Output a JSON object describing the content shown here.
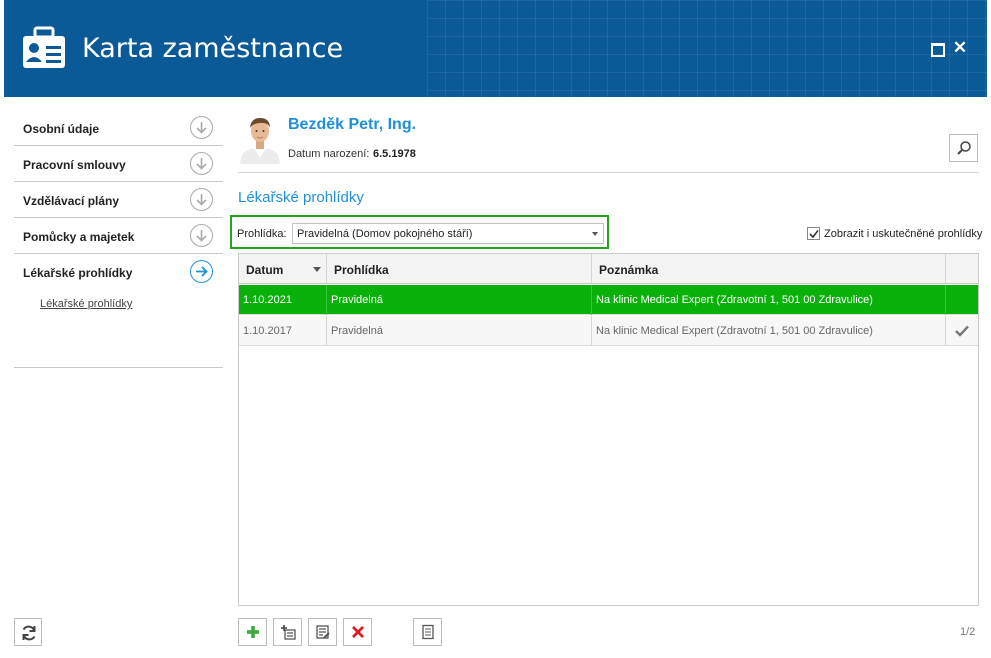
{
  "window": {
    "title": "Karta zaměstnance"
  },
  "sidebar": {
    "items": [
      {
        "label": "Osobní údaje"
      },
      {
        "label": "Pracovní smlouvy"
      },
      {
        "label": "Vzdělávací plány"
      },
      {
        "label": "Pomůcky a majetek"
      },
      {
        "label": "Lékařské prohlídky"
      }
    ],
    "sub_link": "Lékařské prohlídky"
  },
  "person": {
    "name": "Bezděk Petr, Ing.",
    "dob_label": "Datum narození:",
    "dob_value": "6.5.1978"
  },
  "section": {
    "title": "Lékařské prohlídky"
  },
  "filter": {
    "label": "Prohlídka:",
    "value": "Pravidelná (Domov pokojného stáří)"
  },
  "show_done": {
    "label": "Zobrazit i uskutečněné prohlídky",
    "checked": true
  },
  "grid": {
    "columns": [
      "Datum",
      "Prohlídka",
      "Poznámka"
    ],
    "rows": [
      {
        "date": "1.10.2021",
        "type": "Pravidelná",
        "note": "Na klinic Medical Expert (Zdravotní 1, 501 00 Zdravulice)",
        "done": false,
        "selected": true
      },
      {
        "date": "1.10.2017",
        "type": "Pravidelná",
        "note": "Na klinic Medical Expert (Zdravotní 1, 501 00 Zdravulice)",
        "done": true,
        "selected": false
      }
    ]
  },
  "pager": "1/2",
  "colors": {
    "header": "#0b5a98",
    "accent": "#1e90d8",
    "selected_row": "#0ab10a",
    "filter_border": "#22a622"
  },
  "icons": [
    "id-card-icon",
    "maximize-icon",
    "close-icon",
    "arrow-down-circle-icon",
    "arrow-right-circle-icon",
    "search-icon",
    "checkmark-icon",
    "add-icon",
    "add-list-icon",
    "edit-icon",
    "delete-icon",
    "document-icon",
    "refresh-icon"
  ]
}
